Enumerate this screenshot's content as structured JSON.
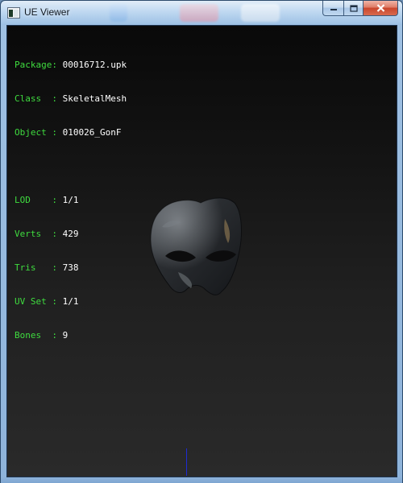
{
  "window": {
    "title": "UE Viewer",
    "app_icon": "viewer-window-icon",
    "controls": {
      "minimize_icon": "minimize-icon",
      "maximize_icon": "maximize-icon",
      "close_icon": "close-icon"
    }
  },
  "info": {
    "package": {
      "label": "Package: ",
      "value": "00016712.upk"
    },
    "class": {
      "label": "Class  : ",
      "value": "SkeletalMesh"
    },
    "object": {
      "label": "Object : ",
      "value": "010026_GonF"
    },
    "lod": {
      "label": "LOD    : ",
      "value": "1/1"
    },
    "verts": {
      "label": "Verts  : ",
      "value": "429"
    },
    "tris": {
      "label": "Tris   : ",
      "value": "738"
    },
    "uvset": {
      "label": "UV Set : ",
      "value": "1/1"
    },
    "bones": {
      "label": "Bones  : ",
      "value": "9"
    }
  },
  "colors": {
    "label": "#3fdc3f",
    "value": "#ffffff",
    "viewport_bg": "#1a1a1a",
    "axis": "#1e2bd4"
  },
  "viewport": {
    "model": "mask-mesh"
  }
}
